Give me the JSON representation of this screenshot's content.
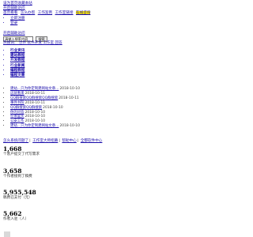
{
  "top_links": {
    "site_home": "设为首页收藏本站",
    "news": "开启辅助访问",
    "nav": [
      {
        "label": "首页看看",
        "highlight": false
      },
      {
        "label": "怎么办帮",
        "highlight": false
      },
      {
        "label": "工作案例",
        "highlight": false
      },
      {
        "label": "工作室链接",
        "highlight": false
      },
      {
        "label": "在线咨询",
        "highlight": true
      }
    ],
    "sub_items": [
      "立即注册",
      "登录"
    ]
  },
  "search": {
    "top_label": "开启辅助访问",
    "placeholder": "请输入搜索内容",
    "value": "请输入搜索内容",
    "button_label": "搜索"
  },
  "hot_words": "热搜词：  世界 软件开发 工作室 回答",
  "categories": [
    "行业资讯",
    "建站教程",
    "开发教程",
    "行业新闻",
    "编程教程",
    "编程文章"
  ],
  "articles": [
    {
      "title": "建站…只为你定制建网站文章…",
      "date": "2018-10-10"
    },
    {
      "title": "这就看来",
      "date": "2018-10-11"
    },
    {
      "title": "QQ群搜索QQ群搜索QQ群搜索",
      "date": "2018-10-11"
    },
    {
      "title": "事件书院",
      "date": "2018-10-11"
    },
    {
      "title": "QQ群搜索QQ群搜索",
      "date": "2018-10-10"
    },
    {
      "title": "你的问答",
      "date": "2018-10-10"
    },
    {
      "title": "在哪里买",
      "date": "2018-10-10"
    },
    {
      "title": "公安工作",
      "date": "2018-10-10"
    },
    {
      "title": "建站…只为你定制建网站文章…",
      "date": "2018-10-10"
    }
  ],
  "footer_links": [
    "怎么系统问题了",
    "工作室大师招募",
    "帮助中心",
    "全都软件中心"
  ],
  "stats": [
    {
      "value": "1,668",
      "label": "个客户提交了代写需求"
    },
    {
      "value": "3,658",
      "label": "个作者接到了稿费"
    },
    {
      "value": "5,955,548",
      "label": "稿费已支付（元）"
    },
    {
      "value": "5,662",
      "label": "作者入驻（人）"
    }
  ]
}
